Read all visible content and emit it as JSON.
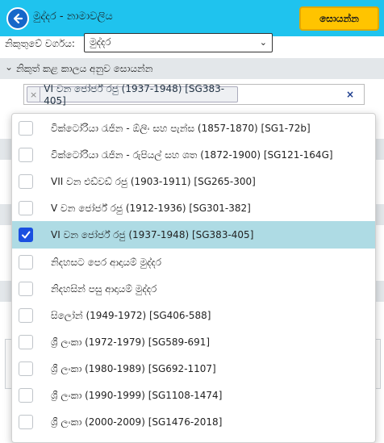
{
  "header": {
    "title": "මුද්දර - නාමාවලිය",
    "search_label": "සොයන්න"
  },
  "category": {
    "label": "නිකුතුවේ වර්ගය:",
    "selected": "මුද්දර"
  },
  "period": {
    "heading": "නිකුත් කළ කාලය අනුව සොයන්න",
    "selected_tag": "VI වන ජෝර්ජ් රජු (1937-1948) [SG383-405]",
    "clear_symbol": "×",
    "remove_symbol": "×"
  },
  "options": [
    {
      "label": "වික්ටෝරියා රැජින - ඕලිං සහ පැන්ස (1857-1870) [SG1-72b]",
      "checked": false
    },
    {
      "label": "වික්ටෝරියා රැජින - රුපියල් සහ ශත (1872-1900) [SG121-164G]",
      "checked": false
    },
    {
      "label": "VII වන එඩ්වඩ් රජු (1903-1911) [SG265-300]",
      "checked": false
    },
    {
      "label": "V වන ජෝර්ජ් රජු (1912-1936) [SG301-382]",
      "checked": false
    },
    {
      "label": "VI වන ජෝර්ජ් රජු (1937-1948) [SG383-405]",
      "checked": true
    },
    {
      "label": "නිදහසට පෙර ආදායම් මුද්දර",
      "checked": false
    },
    {
      "label": "නිදහසින් පසු ආදායම් මුද්දර",
      "checked": false
    },
    {
      "label": "සිලෝන් (1949-1972) [SG406-588]",
      "checked": false
    },
    {
      "label": "ශ්‍රී ලංකා (1972-1979) [SG589-691]",
      "checked": false
    },
    {
      "label": "ශ්‍රී ලංකා (1980-1989) [SG692-1107]",
      "checked": false
    },
    {
      "label": "ශ්‍රී ලංකා (1990-1999) [SG1108-1474]",
      "checked": false
    },
    {
      "label": "ශ්‍රී ලංකා (2000-2009) [SG1476-2018]",
      "checked": false
    }
  ],
  "colors": {
    "header_bg": "#1fc3ee",
    "button_yellow": "#ffc400",
    "selected_row": "#aedbe4",
    "checkbox_checked": "#1a4fe0"
  }
}
